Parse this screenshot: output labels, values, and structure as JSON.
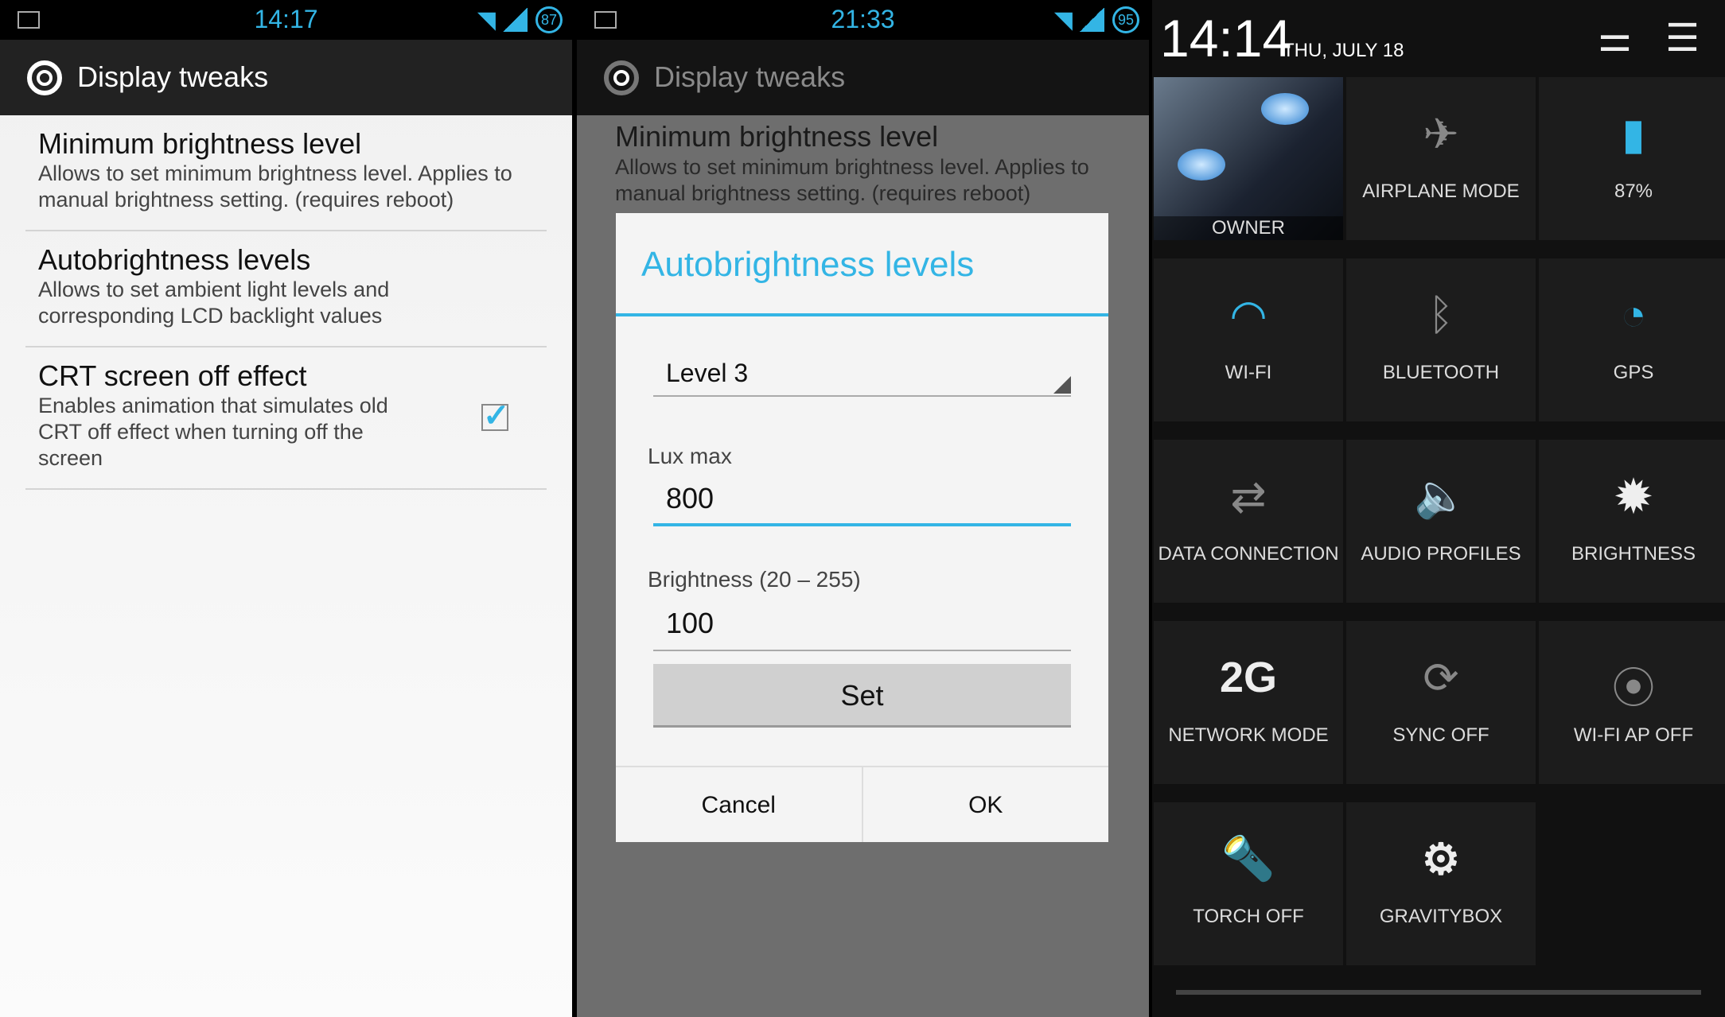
{
  "colors": {
    "accent": "#33b5e5"
  },
  "panel1": {
    "status": {
      "time": "14:17",
      "battery": "87"
    },
    "title": "Display tweaks",
    "items": [
      {
        "title": "Minimum brightness level",
        "desc": "Allows to set minimum brightness level. Applies to manual brightness setting. (requires reboot)"
      },
      {
        "title": "Autobrightness levels",
        "desc": "Allows to set ambient light levels and corresponding LCD backlight values"
      },
      {
        "title": "CRT screen off effect",
        "desc": "Enables animation that simulates old CRT off effect when turning off the screen",
        "checked": true
      }
    ]
  },
  "panel2": {
    "status": {
      "time": "21:33",
      "battery": "95"
    },
    "title": "Display tweaks",
    "bg_item": {
      "title": "Minimum brightness level",
      "desc": "Allows to set minimum brightness level. Applies to manual brightness setting. (requires reboot)"
    },
    "dialog": {
      "title": "Autobrightness levels",
      "level": "Level 3",
      "lux_label": "Lux max",
      "lux_value": "800",
      "brightness_label": "Brightness (20 – 255)",
      "brightness_value": "100",
      "set": "Set",
      "cancel": "Cancel",
      "ok": "OK"
    }
  },
  "panel3": {
    "clock": "14:14",
    "date": "THU, JULY 18",
    "tiles": [
      {
        "label": "OWNER",
        "icon": "user-photo"
      },
      {
        "label": "AIRPLANE MODE",
        "icon": "airplane-icon"
      },
      {
        "label": "87%",
        "icon": "battery-icon"
      },
      {
        "label": "WI-FI",
        "icon": "wifi-icon"
      },
      {
        "label": "BLUETOOTH",
        "icon": "bluetooth-icon"
      },
      {
        "label": "GPS",
        "icon": "gps-icon"
      },
      {
        "label": "DATA CONNECTION",
        "icon": "data-icon"
      },
      {
        "label": "AUDIO PROFILES",
        "icon": "audio-icon"
      },
      {
        "label": "BRIGHTNESS",
        "icon": "brightness-icon"
      },
      {
        "label": "NETWORK MODE",
        "icon": "2G"
      },
      {
        "label": "SYNC OFF",
        "icon": "sync-icon"
      },
      {
        "label": "WI-FI AP OFF",
        "icon": "hotspot-icon"
      },
      {
        "label": "TORCH OFF",
        "icon": "torch-icon"
      },
      {
        "label": "GRAVITYBOX",
        "icon": "gear-icon"
      }
    ]
  }
}
